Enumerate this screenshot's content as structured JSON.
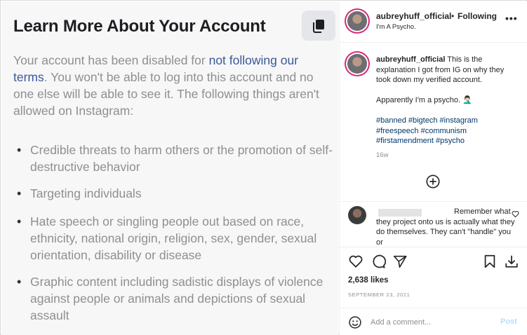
{
  "media": {
    "title": "Learn More About Your Account",
    "paragraph_pre": "Your account has been disabled for ",
    "paragraph_link": "not following our terms",
    "paragraph_post": ". You won't be able to log into this account and no one else will be able to see it. The following things aren't allowed on Instagram:",
    "bullets": [
      "Credible threats to harm others or the promotion of self-destructive behavior",
      "Targeting individuals",
      "Hate speech or singling people out based on race, ethnicity, national origin, religion, sex, gender, sexual orientation, disability or disease",
      "Graphic content including sadistic displays of violence against people or animals and depictions of sexual assault"
    ],
    "bullet_glyph": "•",
    "copy_icon": "copy-icon"
  },
  "header": {
    "username": "aubreyhuff_official",
    "separator": "•",
    "follow_status": "Following",
    "subtitle": "I'm A Psycho.",
    "more_label": "•••"
  },
  "caption": {
    "username": "aubreyhuff_official",
    "text": " This is the explanation I got from IG on why they took down my verified account.",
    "text2": "Apparently I'm a psycho. 🤦🏻‍♂️",
    "hashtags": "#banned #bigtech #instagram #freespeech #communism #firstamendment #psycho",
    "age": "16w",
    "load_more_icon": "plus-circle-icon"
  },
  "comment": {
    "text": "Remember what they project onto us is actually what they do themselves. They can't \"handle\" you or"
  },
  "actions": {
    "likes": "2,638 likes",
    "date": "SEPTEMBER 23, 2021"
  },
  "add_comment": {
    "placeholder": "Add a comment...",
    "post_label": "Post"
  },
  "colors": {
    "link": "#385898",
    "hashtag": "#00376b",
    "post_disabled": "#b2dffc",
    "story_ring": "#d62976"
  }
}
